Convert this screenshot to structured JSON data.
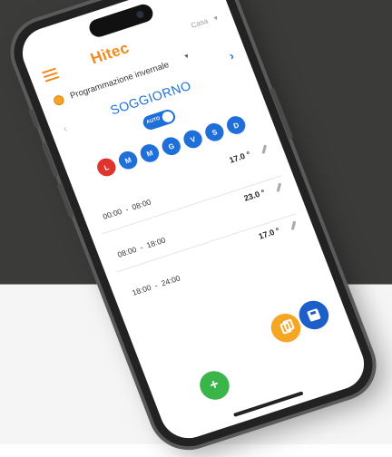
{
  "app": {
    "logo": "Hitec",
    "logo_subtitle": "",
    "house_selector": "Casa"
  },
  "program": {
    "label": "Programmazione invernale"
  },
  "room": {
    "name": "SOGGIORNO"
  },
  "mode_toggle": {
    "label": "AUTO",
    "state": "on"
  },
  "days": [
    {
      "label": "L",
      "selected": true
    },
    {
      "label": "M",
      "selected": false
    },
    {
      "label": "M",
      "selected": false
    },
    {
      "label": "G",
      "selected": false
    },
    {
      "label": "V",
      "selected": false
    },
    {
      "label": "S",
      "selected": false
    },
    {
      "label": "D",
      "selected": false
    }
  ],
  "slots": [
    {
      "start": "00:00",
      "end": "08:00",
      "temperature": "17.0 °"
    },
    {
      "start": "08:00",
      "end": "18:00",
      "temperature": "23.0 °"
    },
    {
      "start": "18:00",
      "end": "24:00",
      "temperature": "17.0 °"
    }
  ],
  "actions": {
    "add": "+"
  },
  "colors": {
    "accent_orange": "#f08a1c",
    "accent_blue": "#1e6fd9",
    "day_selected": "#e0332e",
    "add_green": "#3ab54a",
    "copy_yellow": "#f5a623",
    "save_blue": "#1e5ec9",
    "background_dark": "#3b3b3a"
  }
}
